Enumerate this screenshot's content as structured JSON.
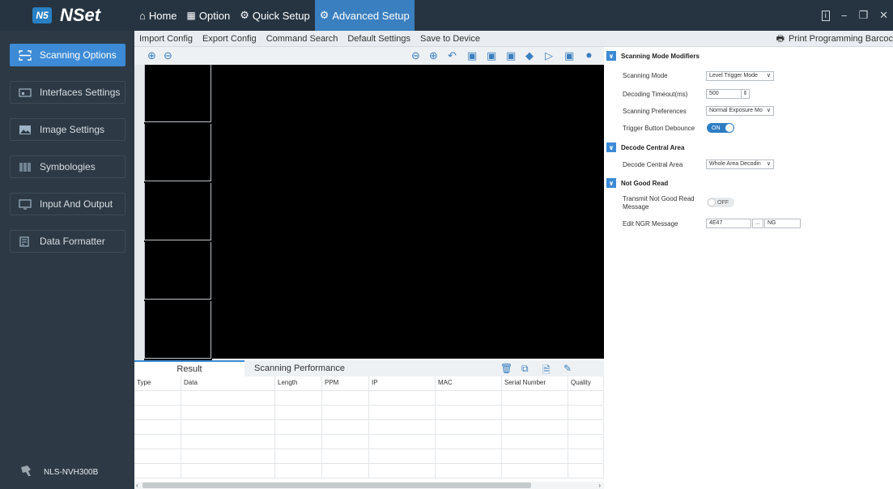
{
  "app": {
    "logo_text": "N5",
    "name": "NSet"
  },
  "topnav": [
    {
      "label": "Home",
      "icon": "home-icon"
    },
    {
      "label": "Option",
      "icon": "option-icon"
    },
    {
      "label": "Quick Setup",
      "icon": "gear-icon"
    },
    {
      "label": "Advanced Setup",
      "icon": "gears-icon"
    }
  ],
  "window_controls": {
    "info": "i",
    "minimize": "−",
    "restore": "❐",
    "close": "✕"
  },
  "sidebar": {
    "items": [
      {
        "label": "Scanning Options",
        "icon": "scan-icon"
      },
      {
        "label": "Interfaces Settings",
        "icon": "interface-icon"
      },
      {
        "label": "Image Settings",
        "icon": "image-icon"
      },
      {
        "label": "Symbologies",
        "icon": "barcode-icon"
      },
      {
        "label": "Input And Output",
        "icon": "monitor-icon"
      },
      {
        "label": "Data Formatter",
        "icon": "edit-icon"
      }
    ],
    "device": "NLS-NVH300B"
  },
  "toolbar": {
    "items": [
      "Import Config",
      "Export Config",
      "Command Search",
      "Default Settings",
      "Save to Device"
    ],
    "print": "Print Programming Barcoc"
  },
  "result_tabs": [
    "Result",
    "Scanning Performance"
  ],
  "result_table": {
    "headers": [
      "Type",
      "Data",
      "Length",
      "PPM",
      "IP",
      "MAC",
      "Serial Number",
      "Quality"
    ]
  },
  "props": {
    "sections": [
      {
        "title": "Scanning Mode Modifiers"
      },
      {
        "title": "Decode Central Area"
      },
      {
        "title": "Not Good Read"
      }
    ],
    "scanning_mode": {
      "label": "Scanning Mode",
      "value": "Level Trigger Mode"
    },
    "decoding_timeout": {
      "label": "Decoding Timeout(ms)",
      "value": "500"
    },
    "scanning_preferences": {
      "label": "Scanning Preferences",
      "value": "Normal Exposure Mo"
    },
    "trigger_debounce": {
      "label": "Trigger Button Debounce",
      "value": "ON"
    },
    "decode_central_area": {
      "label": "Decode Central Area",
      "value": "Whole Area Decodin"
    },
    "transmit_ngr": {
      "label": "Transmit Not Good Read Message",
      "value": "OFF"
    },
    "edit_ngr": {
      "label": "Edit NGR Message",
      "hex": "4E47",
      "ellipsis": "...",
      "text": "NG"
    }
  },
  "colors": {
    "accent": "#3d8bd6",
    "sidebar": "#2d3a45",
    "topbar": "#263441"
  }
}
